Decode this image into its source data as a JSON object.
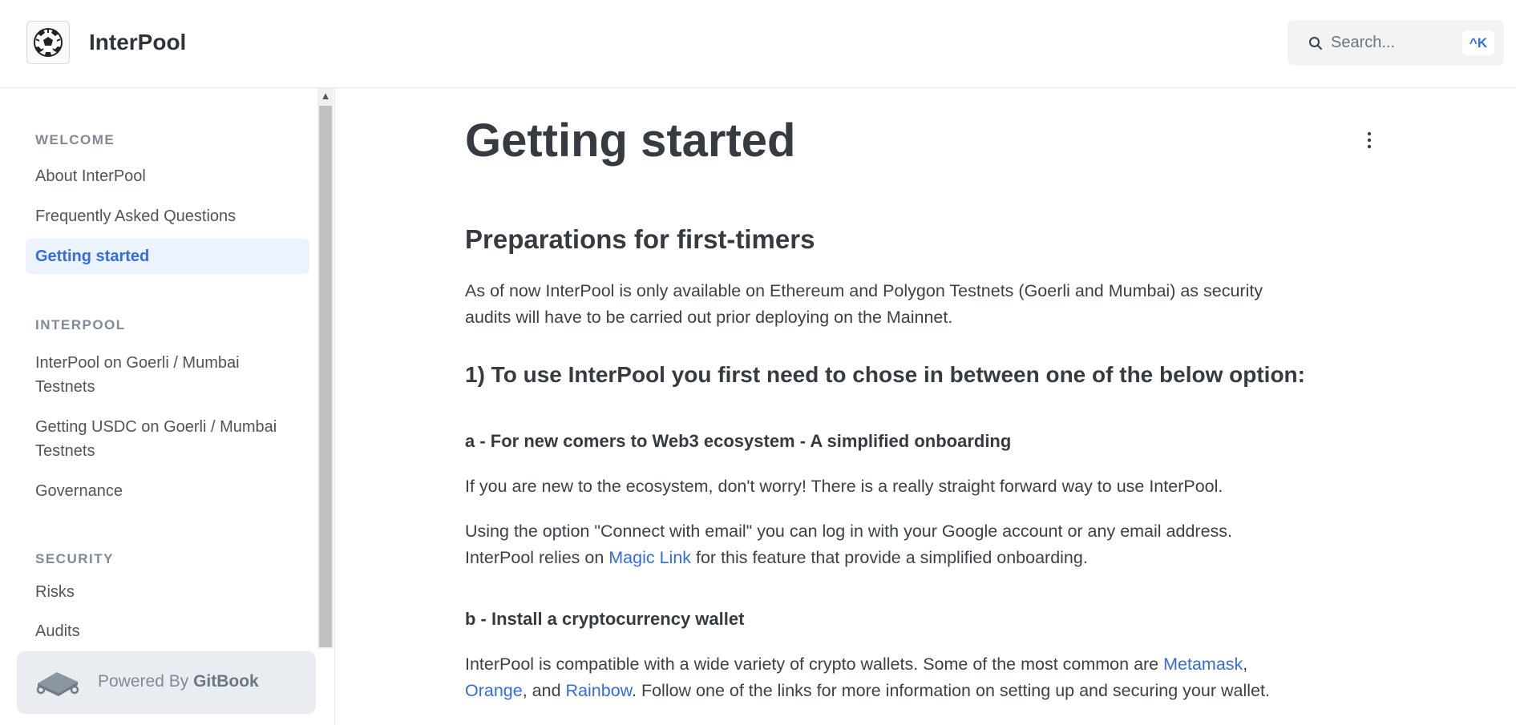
{
  "header": {
    "site_title": "InterPool",
    "logo_icon": "soccer-ball-icon",
    "search": {
      "placeholder": "Search...",
      "shortcut": "^K"
    }
  },
  "sidebar": {
    "sections": [
      {
        "title": "WELCOME",
        "items": [
          {
            "label": "About InterPool"
          },
          {
            "label": "Frequently Asked Questions"
          },
          {
            "label": "Getting started",
            "active": true
          }
        ]
      },
      {
        "title": "INTERPOOL",
        "items": [
          {
            "label_line1": "InterPool on Goerli / Mumbai",
            "label_line2": "Testnets"
          },
          {
            "label_line1": "Getting USDC on Goerli / Mumbai",
            "label_line2": "Testnets"
          },
          {
            "label": "Governance"
          }
        ]
      },
      {
        "title": "SECURITY",
        "items": [
          {
            "label": "Risks"
          },
          {
            "label": "Audits"
          }
        ]
      }
    ],
    "powered_by": {
      "prefix": "Powered By",
      "brand": "GitBook"
    }
  },
  "main": {
    "title": "Getting started",
    "h2": "Preparations for first-timers",
    "intro_line1": "As of now InterPool is only available on Ethereum and Polygon Testnets (Goerli and Mumbai) as security",
    "intro_line2": "audits will have to be carried out prior deploying on the Mainnet.",
    "h3": "1) To use InterPool you first need to chose in between one  of the below option:",
    "option_a": {
      "heading": "a - For new comers to Web3 ecosystem - A simplified onboarding",
      "para1": "If you are new to the ecosystem, don't worry! There is a really straight forward way to use InterPool.",
      "para2_line1": "Using the option \"Connect with email\" you can log in with your Google account or any email address.",
      "para2_line2_pre": "InterPool relies on ",
      "para2_link": "Magic Link",
      "para2_line2_post": " for this feature that provide a simplified onboarding."
    },
    "option_b": {
      "heading": "b - Install a cryptocurrency wallet",
      "line1_pre": "InterPool is compatible with a wide variety of crypto wallets. Some of the most common are ",
      "link_metamask": "Metamask",
      "sep1": ",",
      "link_orange": "Orange",
      "sep2": ", and ",
      "link_rainbow": "Rainbow",
      "line2_post": ". Follow one of the links for more information on setting up and securing your wallet."
    }
  },
  "colors": {
    "accent": "#346ddb",
    "active_bg": "#edf3fd",
    "section_title": "#7e8a96"
  }
}
